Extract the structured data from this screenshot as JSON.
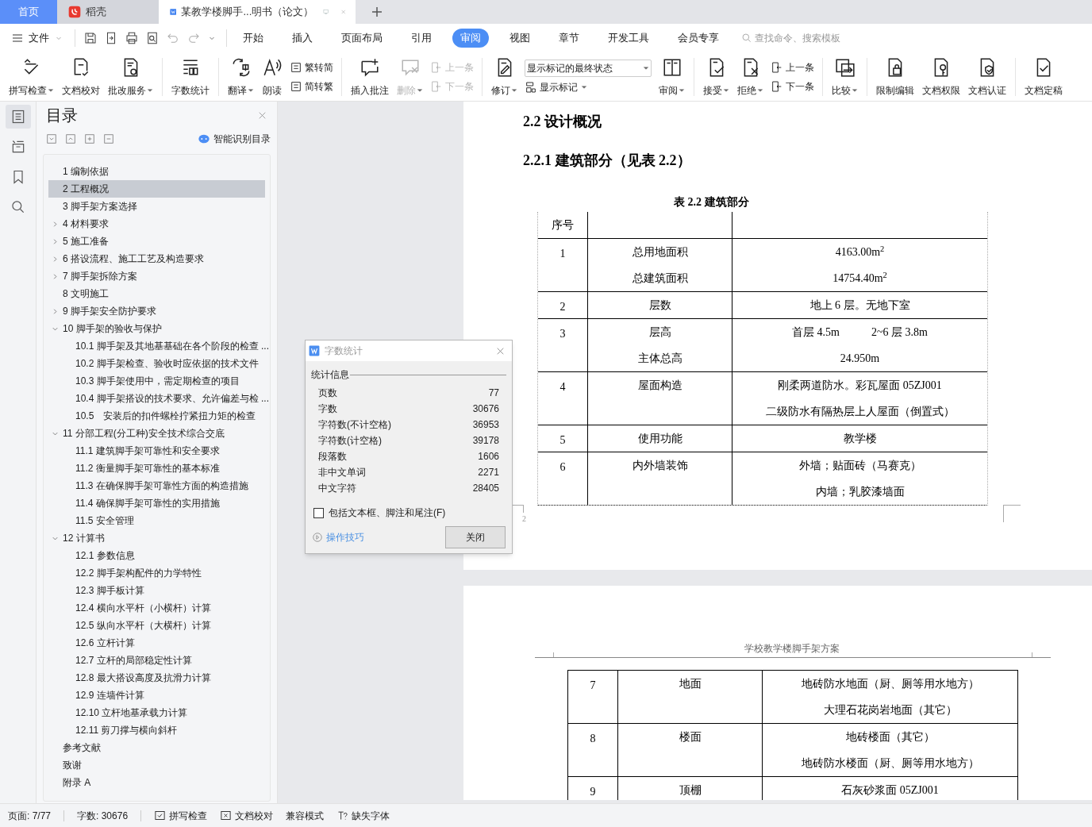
{
  "tabs": [
    {
      "label": "首页",
      "kind": "home",
      "selected": false
    },
    {
      "label": "稻壳",
      "kind": "app",
      "selected": false
    },
    {
      "label": "某教学楼脚手...明书（论文）",
      "kind": "doc",
      "selected": true
    }
  ],
  "menu": {
    "file": "文件",
    "tabs": [
      {
        "label": "开始",
        "selected": false
      },
      {
        "label": "插入",
        "selected": false
      },
      {
        "label": "页面布局",
        "selected": false
      },
      {
        "label": "引用",
        "selected": false
      },
      {
        "label": "审阅",
        "selected": true
      },
      {
        "label": "视图",
        "selected": false
      },
      {
        "label": "章节",
        "selected": false
      },
      {
        "label": "开发工具",
        "selected": false
      },
      {
        "label": "会员专享",
        "selected": false
      }
    ],
    "search": {
      "placeholder": "查找命令、搜索模板"
    }
  },
  "ribbon": [
    {
      "kind": "big",
      "label": "拼写检查",
      "dropdown": true,
      "disabled": false
    },
    {
      "kind": "big",
      "label": "文档校对",
      "dropdown": false,
      "disabled": false
    },
    {
      "kind": "big",
      "label": "批改服务",
      "dropdown": true,
      "disabled": false
    },
    {
      "kind": "separator"
    },
    {
      "kind": "big",
      "label": "字数统计",
      "dropdown": false,
      "disabled": false
    },
    {
      "kind": "separator"
    },
    {
      "kind": "big",
      "label": "翻译",
      "dropdown": true,
      "disabled": false
    },
    {
      "kind": "big",
      "label": "朗读",
      "dropdown": false,
      "disabled": false
    },
    {
      "kind": "stack",
      "items": [
        {
          "label": "繁转简",
          "disabled": false
        },
        {
          "label": "简转繁",
          "disabled": false
        }
      ]
    },
    {
      "kind": "separator"
    },
    {
      "kind": "big",
      "label": "插入批注",
      "dropdown": false,
      "disabled": false
    },
    {
      "kind": "big",
      "label": "删除",
      "dropdown": true,
      "disabled": true
    },
    {
      "kind": "stack",
      "items": [
        {
          "label": "上一条",
          "disabled": true
        },
        {
          "label": "下一条",
          "disabled": true
        }
      ]
    },
    {
      "kind": "separator"
    },
    {
      "kind": "big",
      "label": "修订",
      "dropdown": true,
      "disabled": false
    },
    {
      "kind": "select",
      "value": "显示标记的最终状态",
      "item": {
        "label": "显示标记",
        "dropdown": true
      }
    },
    {
      "kind": "big",
      "label": "审阅",
      "dropdown": true,
      "disabled": false
    },
    {
      "kind": "separator"
    },
    {
      "kind": "big",
      "label": "接受",
      "dropdown": true,
      "disabled": false
    },
    {
      "kind": "big",
      "label": "拒绝",
      "dropdown": true,
      "disabled": false
    },
    {
      "kind": "stack",
      "items": [
        {
          "label": "上一条",
          "disabled": false
        },
        {
          "label": "下一条",
          "disabled": false
        }
      ]
    },
    {
      "kind": "separator"
    },
    {
      "kind": "big",
      "label": "比较",
      "dropdown": true,
      "disabled": false
    },
    {
      "kind": "separator"
    },
    {
      "kind": "big",
      "label": "限制编辑",
      "dropdown": false,
      "disabled": false
    },
    {
      "kind": "big",
      "label": "文档权限",
      "dropdown": false,
      "disabled": false
    },
    {
      "kind": "big",
      "label": "文档认证",
      "dropdown": false,
      "disabled": false
    },
    {
      "kind": "separator"
    },
    {
      "kind": "big",
      "label": "文档定稿",
      "dropdown": false,
      "disabled": false
    }
  ],
  "sidebar": {
    "items": [
      {
        "selected": true
      },
      {
        "selected": false
      },
      {
        "selected": false
      },
      {
        "selected": false
      }
    ]
  },
  "toc": {
    "title": "目录",
    "smart_button": "智能识别目录",
    "items": [
      {
        "label": "1 编制依据",
        "selected": false
      },
      {
        "label": "2 工程概况",
        "selected": true
      },
      {
        "label": "3 脚手架方案选择",
        "selected": false
      },
      {
        "label": "4 材料要求",
        "expanded": false,
        "selected": false
      },
      {
        "label": "5 施工准备",
        "expanded": false,
        "selected": false
      },
      {
        "label": "6 搭设流程、施工工艺及构造要求",
        "expanded": false,
        "selected": false
      },
      {
        "label": "7 脚手架拆除方案",
        "expanded": false,
        "selected": false
      },
      {
        "label": "8 文明施工",
        "selected": false
      },
      {
        "label": "9 脚手架安全防护要求",
        "expanded": false,
        "selected": false
      },
      {
        "label": "10 脚手架的验收与保护",
        "expanded": true,
        "selected": false,
        "children": [
          {
            "label": "10.1 脚手架及其地基基础在各个阶段的检查 ...",
            "selected": false
          },
          {
            "label": "10.2 脚手架检查、验收时应依据的技术文件",
            "selected": false
          },
          {
            "label": "10.3 脚手架使用中，需定期检查的项目",
            "selected": false
          },
          {
            "label": "10.4 脚手架搭设的技术要求、允许偏差与检 ...",
            "selected": false
          },
          {
            "label": "10.5　安装后的扣件螺栓拧紧扭力矩的检查",
            "selected": false
          }
        ]
      },
      {
        "label": "11 分部工程(分工种)安全技术综合交底",
        "expanded": true,
        "selected": false,
        "children": [
          {
            "label": "11.1 建筑脚手架可靠性和安全要求",
            "selected": false
          },
          {
            "label": "11.2 衡量脚手架可靠性的基本标准",
            "selected": false
          },
          {
            "label": "11.3 在确保脚手架可靠性方面的构造措施",
            "selected": false
          },
          {
            "label": "11.4 确保脚手架可靠性的实用措施",
            "selected": false
          },
          {
            "label": "11.5 安全管理",
            "selected": false
          }
        ]
      },
      {
        "label": "12 计算书",
        "expanded": true,
        "selected": false,
        "children": [
          {
            "label": "12.1 参数信息",
            "selected": false
          },
          {
            "label": "12.2 脚手架构配件的力学特性",
            "selected": false
          },
          {
            "label": "12.3 脚手板计算",
            "selected": false
          },
          {
            "label": "12.4 横向水平杆（小横杆）计算",
            "selected": false
          },
          {
            "label": "12.5 纵向水平杆（大横杆）计算",
            "selected": false
          },
          {
            "label": "12.6 立杆计算",
            "selected": false
          },
          {
            "label": "12.7 立杆的局部稳定性计算",
            "selected": false
          },
          {
            "label": "12.8 最大搭设高度及抗滑力计算",
            "selected": false
          },
          {
            "label": "12.9 连墙件计算",
            "selected": false
          },
          {
            "label": "12.10 立杆地基承载力计算",
            "selected": false
          },
          {
            "label": "12.11 剪刀撑与横向斜杆",
            "selected": false
          }
        ]
      },
      {
        "label": "参考文献",
        "selected": false
      },
      {
        "label": "致谢",
        "selected": false
      },
      {
        "label": "附录 A",
        "selected": false
      }
    ]
  },
  "document": {
    "page1": {
      "heading": "2.2  设计概况",
      "subheading": "2.2.1 建筑部分（见表 2.2）",
      "caption": "表 2.2  建筑部分",
      "header": "序号",
      "rows": [
        {
          "number": "1",
          "lines": [
            {
              "item": "总用地面积",
              "values": [
                "4163.00m$^{2}$"
              ]
            },
            {
              "item": "总建筑面积",
              "values": [
                "14754.40m$^{2}$"
              ]
            }
          ]
        },
        {
          "number": "2",
          "lines": [
            {
              "item": "层数",
              "values": [
                "地上 6 层。无地下室"
              ]
            }
          ]
        },
        {
          "number": "3",
          "lines": [
            {
              "item": "层高",
              "values": [
                "首层 4.5m",
                "2~6 层 3.8m"
              ]
            },
            {
              "item": "主体总高",
              "values": [
                "24.950m"
              ]
            }
          ]
        },
        {
          "number": "4",
          "lines": [
            {
              "item": "屋面构造",
              "values": [
                "刚柔两道防水。彩瓦屋面 05ZJ001"
              ]
            },
            {
              "values": [
                "二级防水有隔热层上人屋面（倒置式）"
              ]
            }
          ]
        },
        {
          "number": "5",
          "lines": [
            {
              "item": "使用功能",
              "values": [
                "教学楼"
              ]
            }
          ]
        },
        {
          "number": "6",
          "lines": [
            {
              "item": "内外墙装饰",
              "values": [
                "外墙；贴面砖（马赛克）"
              ]
            },
            {
              "values": [
                "内墙；乳胶漆墙面"
              ]
            }
          ]
        }
      ],
      "page_number": "2"
    },
    "page2": {
      "header": "学校教学楼脚手架方案",
      "rows": [
        {
          "number": "7",
          "lines": [
            {
              "item": "地面",
              "values": [
                "地砖防水地面（厨、厕等用水地方）"
              ]
            },
            {
              "values": [
                "大理石花岗岩地面（其它）"
              ]
            }
          ]
        },
        {
          "number": "8",
          "lines": [
            {
              "item": "楼面",
              "values": [
                "地砖楼面（其它）"
              ]
            },
            {
              "values": [
                "地砖防水楼面（厨、厕等用水地方）"
              ]
            }
          ]
        },
        {
          "number": "9",
          "lines": [
            {
              "item": "顶棚",
              "values": [
                "石灰砂浆面 05ZJ001"
              ]
            }
          ]
        }
      ]
    }
  },
  "dialog": {
    "title": "字数统计",
    "section": "统计信息",
    "stats": [
      {
        "label": "页数",
        "value": "77"
      },
      {
        "label": "字数",
        "value": "30676"
      },
      {
        "label": "字符数(不计空格)",
        "value": "36953"
      },
      {
        "label": "字符数(计空格)",
        "value": "39178"
      },
      {
        "label": "段落数",
        "value": "1606"
      },
      {
        "label": "非中文单词",
        "value": "2271"
      },
      {
        "label": "中文字符",
        "value": "28405"
      }
    ],
    "checkbox": {
      "label": "包括文本框、脚注和尾注(F)",
      "checked": false
    },
    "link": "操作技巧",
    "button": "关闭"
  },
  "status_bar": [
    {
      "label": "页面: 7/77",
      "kind": "text"
    },
    {
      "label": "字数: 30676",
      "kind": "text"
    },
    {
      "label": "拼写检查",
      "kind": "check"
    },
    {
      "label": "文档校对",
      "kind": "cross"
    },
    {
      "label": "兼容模式",
      "kind": "text"
    },
    {
      "label": "缺失字体",
      "kind": "font"
    }
  ]
}
